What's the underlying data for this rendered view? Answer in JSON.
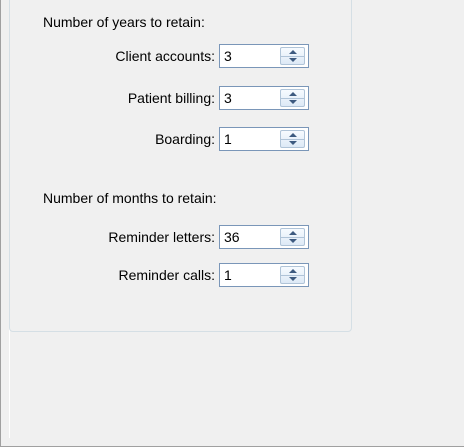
{
  "years": {
    "title": "Number of years to retain:",
    "rows": [
      {
        "label": "Client accounts:",
        "value": "3"
      },
      {
        "label": "Patient billing:",
        "value": "3"
      },
      {
        "label": "Boarding:",
        "value": "1"
      }
    ]
  },
  "months": {
    "title": "Number of months to retain:",
    "rows": [
      {
        "label": "Reminder letters:",
        "value": "36"
      },
      {
        "label": "Reminder calls:",
        "value": "1"
      }
    ]
  },
  "colors": {
    "background": "#f0f0f0",
    "field_border": "#7a96b8",
    "spin_arrow": "#3d5a80"
  },
  "icons": {
    "spin_up": "triangle-up",
    "spin_down": "triangle-down"
  }
}
